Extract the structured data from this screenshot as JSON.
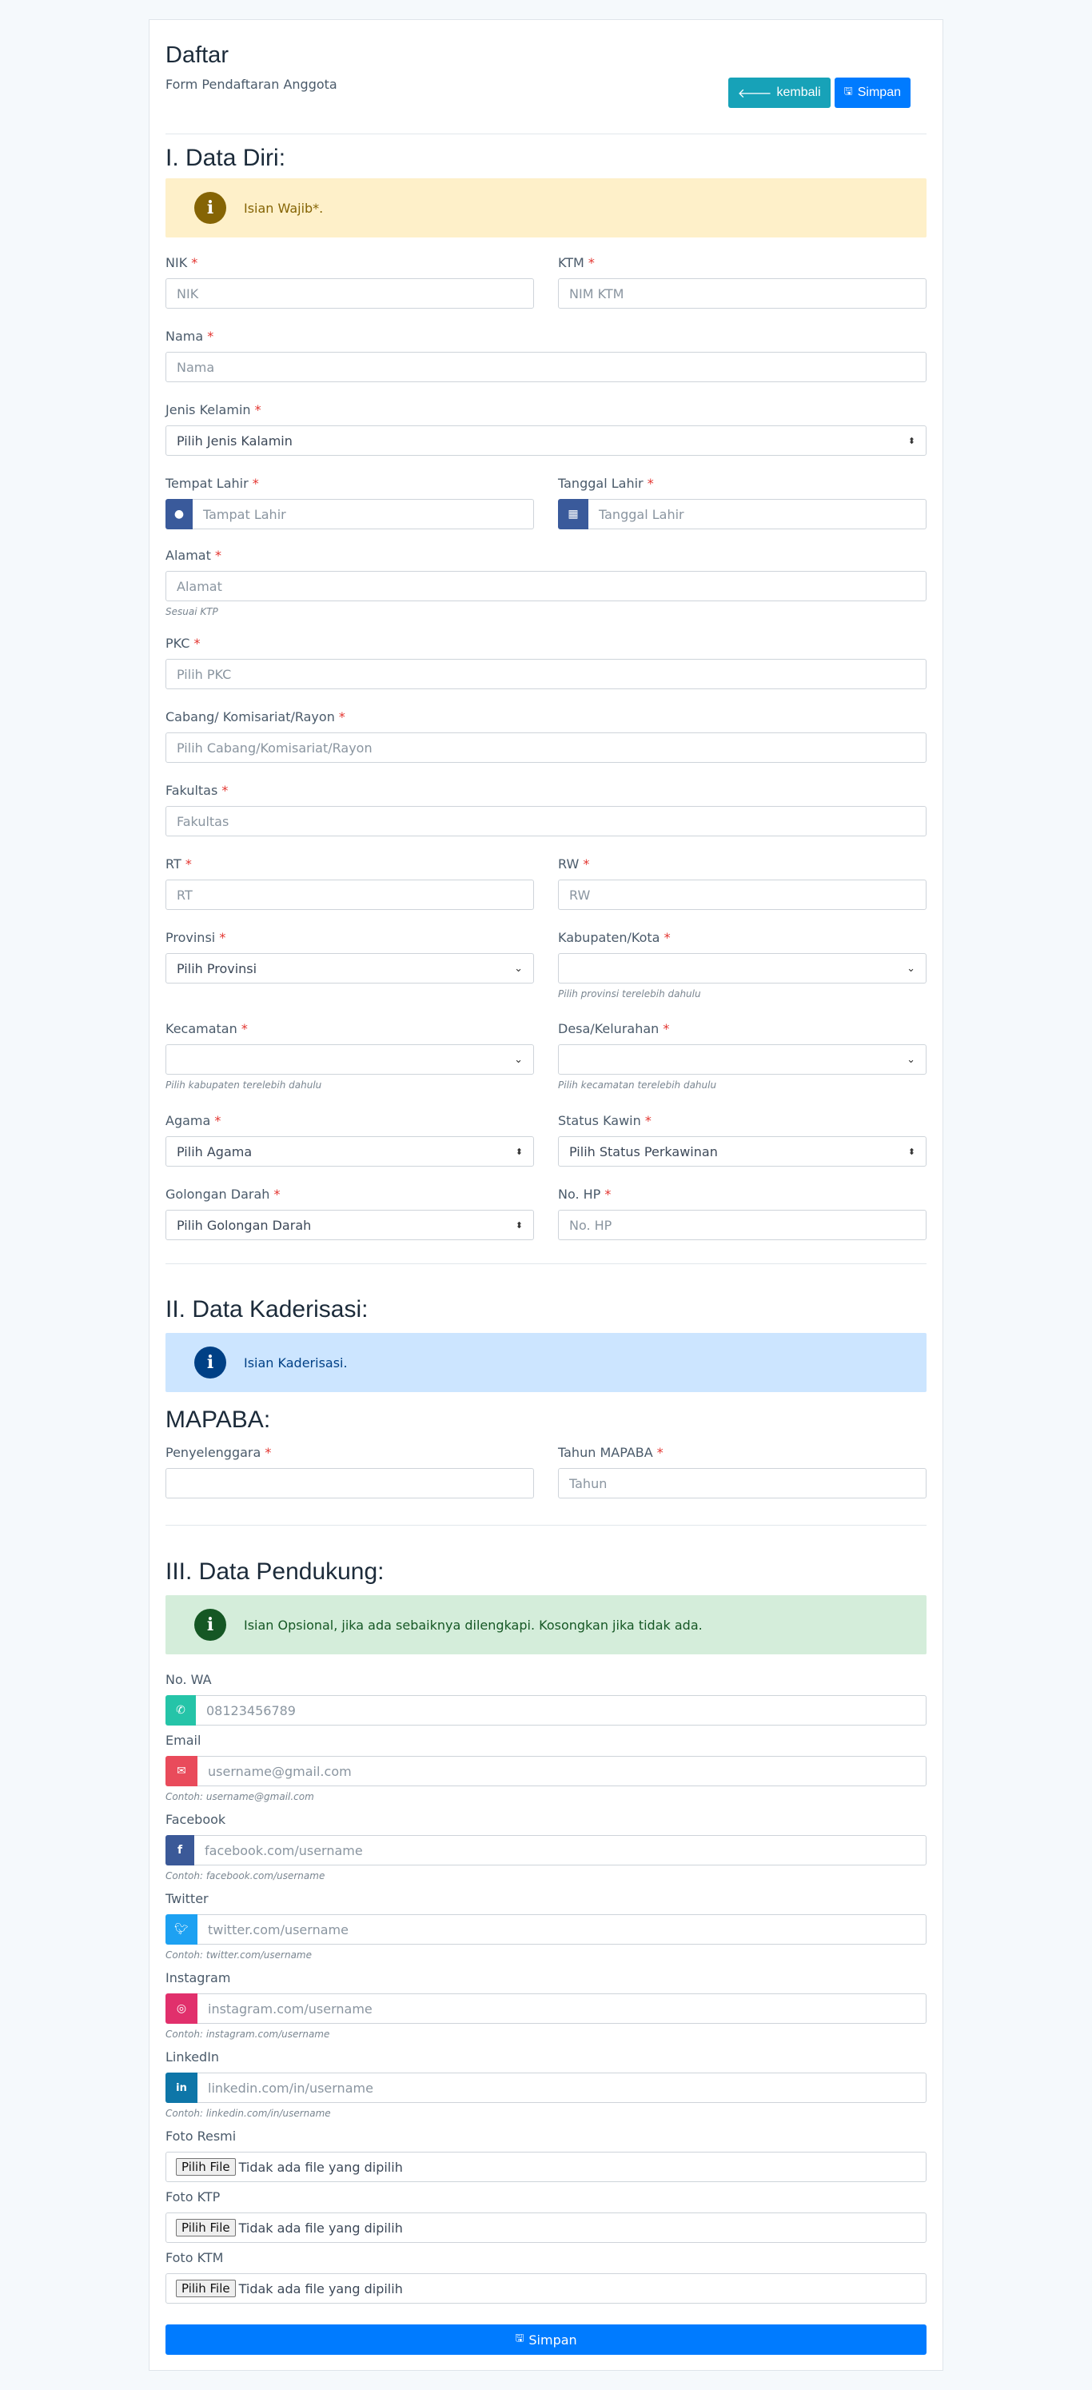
{
  "header": {
    "title": "Daftar",
    "subtitle": "Form Pendaftaran Anggota",
    "back_label": "kembali",
    "save_label": "Simpan"
  },
  "section1": {
    "title": "I. Data Diri:",
    "alert": "Isian Wajib*."
  },
  "fields": {
    "nik": {
      "label": "NIK",
      "placeholder": "NIK"
    },
    "ktm": {
      "label": "KTM",
      "placeholder": "NIM KTM"
    },
    "nama": {
      "label": "Nama",
      "placeholder": "Nama"
    },
    "jenis_kelamin": {
      "label": "Jenis Kelamin",
      "value": "Pilih Jenis Kalamin"
    },
    "tempat_lahir": {
      "label": "Tempat Lahir",
      "placeholder": "Tampat Lahir"
    },
    "tanggal_lahir": {
      "label": "Tanggal Lahir",
      "placeholder": "Tanggal Lahir"
    },
    "alamat": {
      "label": "Alamat",
      "placeholder": "Alamat",
      "hint": "Sesuai KTP"
    },
    "pkc": {
      "label": "PKC",
      "placeholder": "Pilih PKC"
    },
    "cabang": {
      "label": "Cabang/ Komisariat/Rayon",
      "placeholder": "Pilih Cabang/Komisariat/Rayon"
    },
    "fakultas": {
      "label": "Fakultas",
      "placeholder": "Fakultas"
    },
    "rt": {
      "label": "RT",
      "placeholder": "RT"
    },
    "rw": {
      "label": "RW",
      "placeholder": "RW"
    },
    "provinsi": {
      "label": "Provinsi",
      "value": "Pilih Provinsi"
    },
    "kabupaten": {
      "label": "Kabupaten/Kota",
      "value": "",
      "hint": "Pilih provinsi terelebih dahulu"
    },
    "kecamatan": {
      "label": "Kecamatan",
      "value": "",
      "hint": "Pilih kabupaten terelebih dahulu"
    },
    "desa": {
      "label": "Desa/Kelurahan",
      "value": "",
      "hint": "Pilih kecamatan terelebih dahulu"
    },
    "agama": {
      "label": "Agama",
      "value": "Pilih Agama"
    },
    "status_kawin": {
      "label": "Status Kawin",
      "value": "Pilih Status Perkawinan"
    },
    "golongan_darah": {
      "label": "Golongan Darah",
      "value": "Pilih Golongan Darah"
    },
    "no_hp": {
      "label": "No. HP",
      "placeholder": "No. HP"
    }
  },
  "section2": {
    "title": "II. Data Kaderisasi:",
    "alert": "Isian Kaderisasi.",
    "subtitle": "MAPABA:",
    "penyelenggara": {
      "label": "Penyelenggara",
      "placeholder": ""
    },
    "tahun": {
      "label": "Tahun MAPABA",
      "placeholder": "Tahun"
    }
  },
  "section3": {
    "title": "III. Data Pendukung:",
    "alert": "Isian Opsional, jika ada sebaiknya dilengkapi. Kosongkan jika tidak ada.",
    "wa": {
      "label": "No. WA",
      "placeholder": "08123456789",
      "color": "#25c4a8"
    },
    "email": {
      "label": "Email",
      "placeholder": "username@gmail.com",
      "hint": "Contoh: username@gmail.com",
      "color": "#e94b5b"
    },
    "facebook": {
      "label": "Facebook",
      "placeholder": "facebook.com/username",
      "hint": "Contoh: facebook.com/username",
      "color": "#3b5998"
    },
    "twitter": {
      "label": "Twitter",
      "placeholder": "twitter.com/username",
      "hint": "Contoh: twitter.com/username",
      "color": "#1da1f2"
    },
    "instagram": {
      "label": "Instagram",
      "placeholder": "instagram.com/username",
      "hint": "Contoh: instagram.com/username",
      "color": "#e1306c"
    },
    "linkedin": {
      "label": "LinkedIn",
      "placeholder": "linkedin.com/in/username",
      "hint": "Contoh: linkedin.com/in/username",
      "color": "#0e76a8"
    },
    "foto_resmi": {
      "label": "Foto Resmi"
    },
    "foto_ktp": {
      "label": "Foto KTP"
    },
    "foto_ktm": {
      "label": "Foto KTM"
    },
    "file_button": "Pilih File",
    "file_empty": "Tidak ada file yang dipilih"
  },
  "required_mark": "*",
  "submit_label": "Simpan"
}
